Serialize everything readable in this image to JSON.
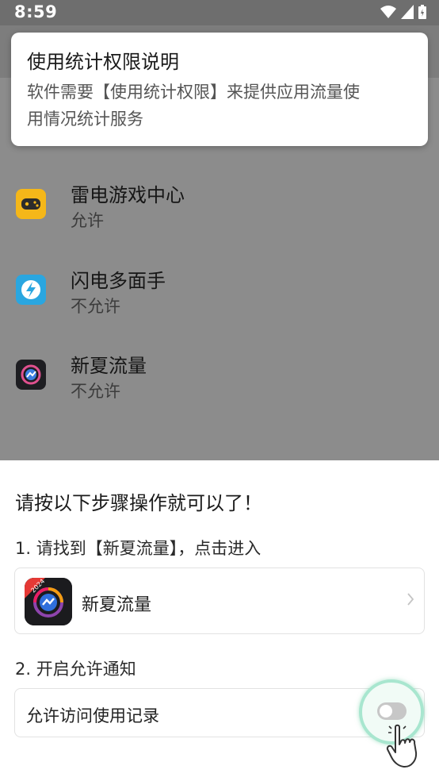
{
  "status_bar": {
    "time": "8:59"
  },
  "permission_card": {
    "title": "使用统计权限说明",
    "desc_line1": "软件需要【使用统计权限】来提供应用流量使",
    "desc_line2": "用情况统计服务"
  },
  "apps": [
    {
      "name": "雷电游戏中心",
      "status": "允许",
      "icon": "gamepad-icon"
    },
    {
      "name": "闪电多面手",
      "status": "不允许",
      "icon": "lightning-icon"
    },
    {
      "name": "新夏流量",
      "status": "不允许",
      "icon": "traffic-icon"
    }
  ],
  "sheet": {
    "title": "请按以下步骤操作就可以了！",
    "step1": "1. 请找到【新夏流量】，点击进入",
    "app_card_name": "新夏流量",
    "app_badge": "2024",
    "step2": "2. 开启允许通知",
    "toggle_label": "允许访问使用记录"
  },
  "colors": {
    "accent_ring": "#a8e6cf",
    "toggle_off": "#c7c7c7"
  }
}
